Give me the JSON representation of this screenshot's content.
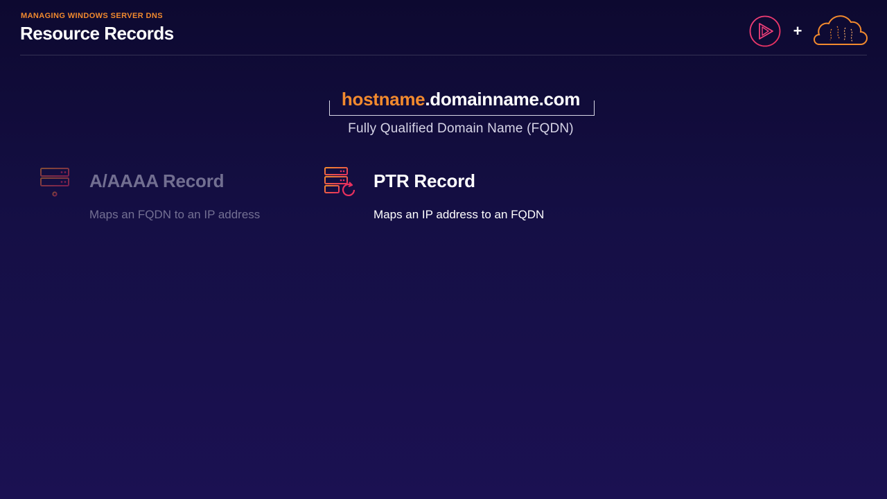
{
  "header": {
    "eyebrow": "MANAGING WINDOWS SERVER DNS",
    "title": "Resource Records",
    "plus": "+"
  },
  "fqdn": {
    "host": "hostname",
    "domain": ".domainname.com",
    "caption": "Fully Qualified Domain Name (FQDN)"
  },
  "records": [
    {
      "name": "A/AAAA Record",
      "description": "Maps an FQDN to an IP address",
      "icon": "server-icon"
    },
    {
      "name": "PTR Record",
      "description": "Maps an IP address to an FQDN",
      "icon": "server-refresh-icon"
    }
  ],
  "colors": {
    "accent_orange": "#f28a2e",
    "accent_pink": "#e8305e",
    "background": "#150f45"
  }
}
